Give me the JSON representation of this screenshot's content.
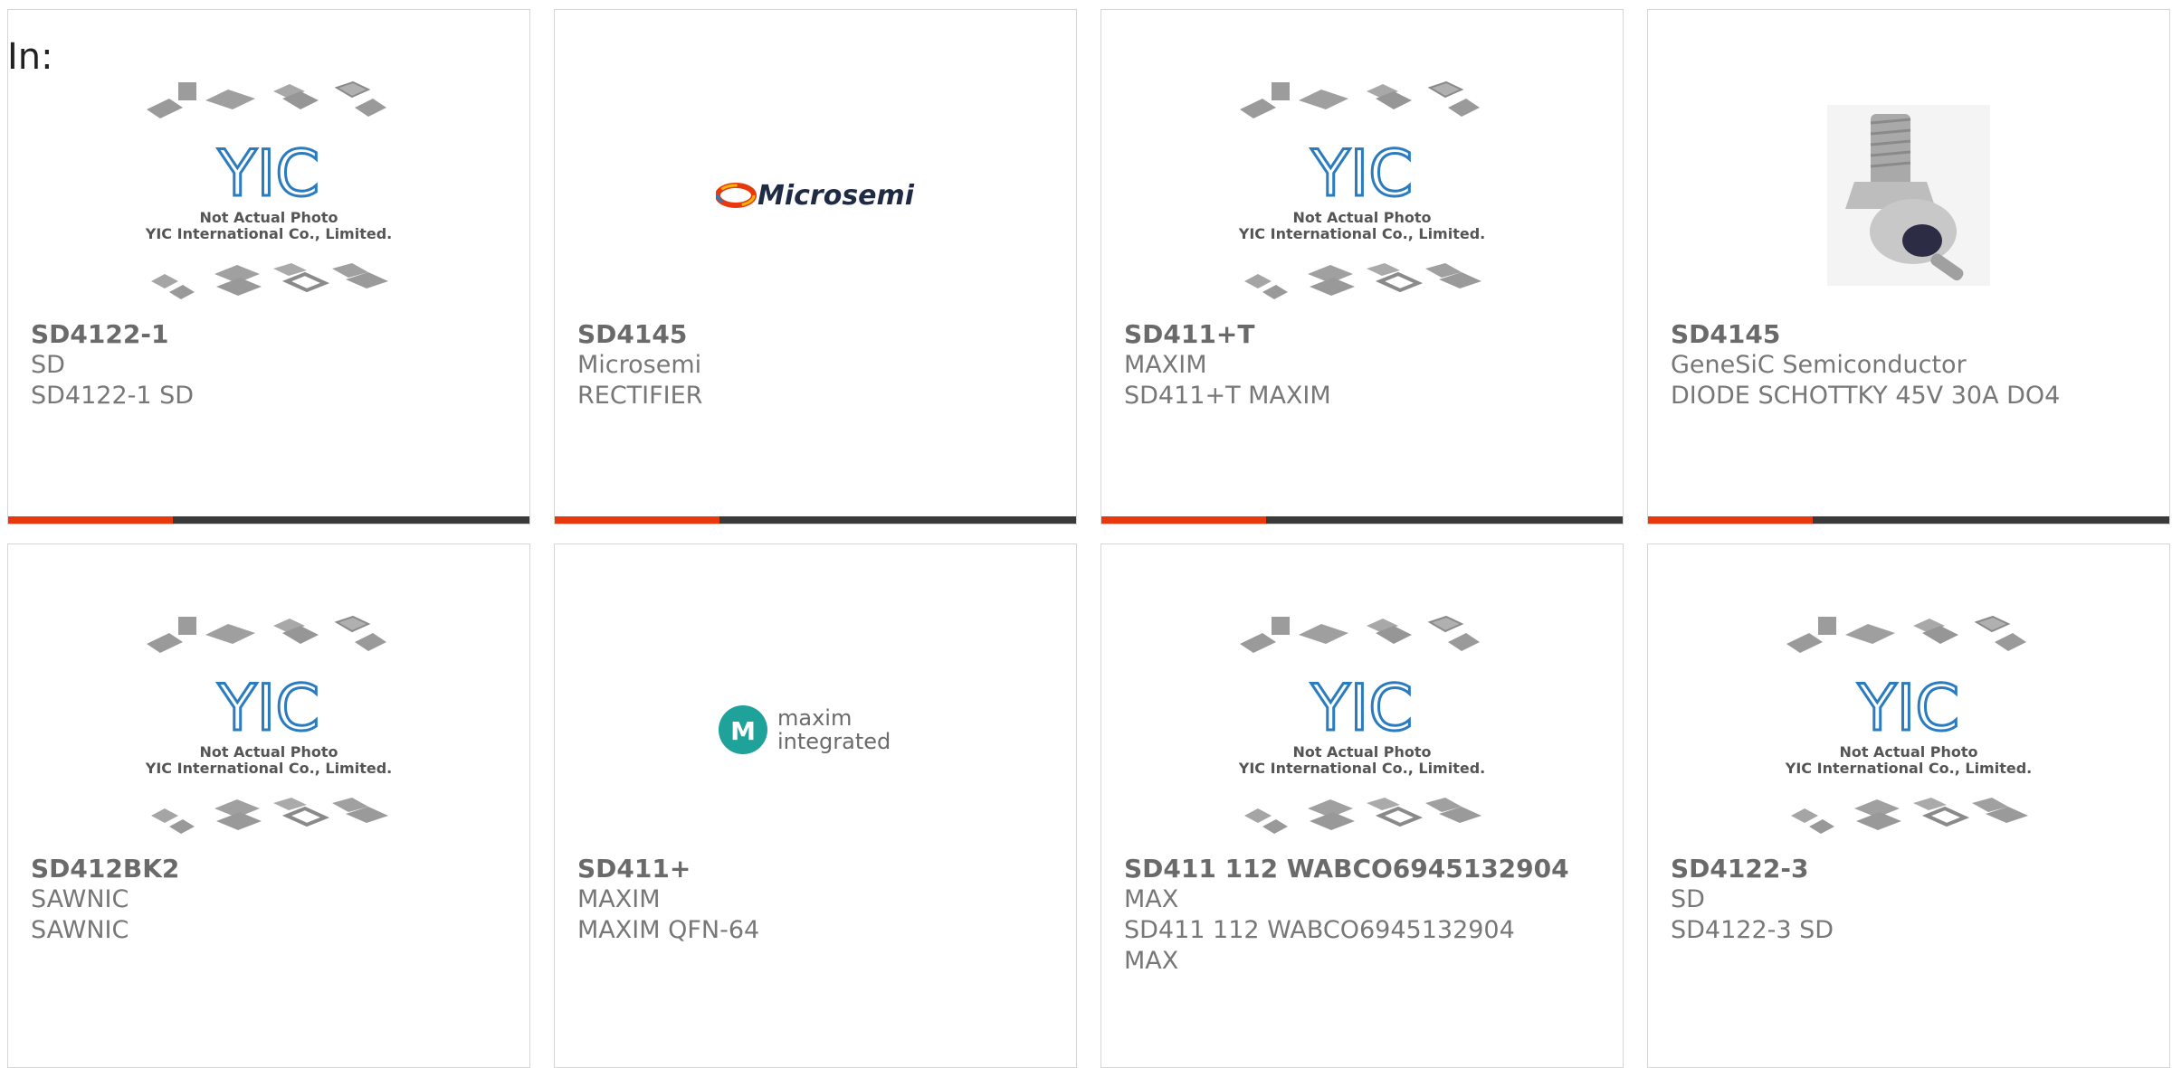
{
  "header": {
    "label": "In:"
  },
  "placeholder": {
    "line1": "Not Actual Photo",
    "line2": "YIC International Co., Limited.",
    "logo": "YIC"
  },
  "logos": {
    "microsemi": "Microsemi",
    "maxim1": "maxim",
    "maxim2": "integrated"
  },
  "products": [
    {
      "title": "SD4122-1",
      "brand": "SD",
      "desc": "SD4122-1 SD"
    },
    {
      "title": "SD4145",
      "brand": "Microsemi",
      "desc": "RECTIFIER"
    },
    {
      "title": "SD411+T",
      "brand": "MAXIM",
      "desc": "SD411+T MAXIM"
    },
    {
      "title": "SD4145",
      "brand": "GeneSiC Semiconductor",
      "desc": "DIODE SCHOTTKY 45V 30A DO4"
    },
    {
      "title": "SD412BK2",
      "brand": "SAWNIC",
      "desc": "SAWNIC"
    },
    {
      "title": "SD411+",
      "brand": "MAXIM",
      "desc": "MAXIM QFN-64"
    },
    {
      "title": "SD411 112 WABCO6945132904",
      "brand": "MAX",
      "desc": "SD411 112 WABCO6945132904",
      "desc2": "MAX"
    },
    {
      "title": "SD4122-3",
      "brand": "SD",
      "desc": "SD4122-3 SD"
    }
  ],
  "colors": {
    "accent": "#e8380d",
    "bar": "#3a3a3a",
    "yic": "#2a7bc0",
    "microsemi": "#1f2a44",
    "maxim": "#1fa29a"
  }
}
